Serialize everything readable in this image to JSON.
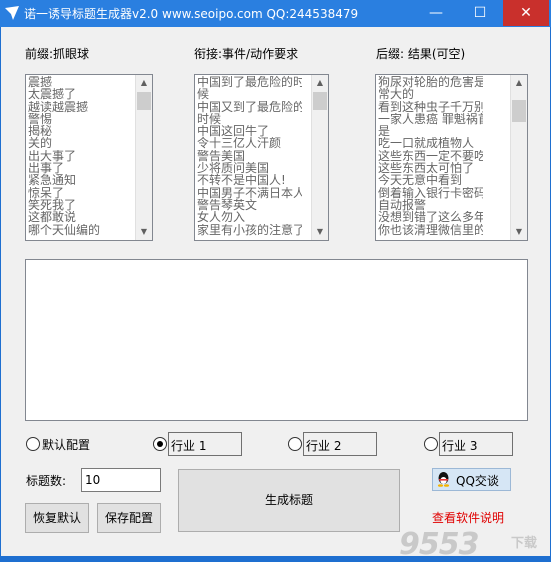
{
  "window": {
    "title": "诺一诱导标题生成器v2.0 www.seoipo.com QQ:244538479",
    "min_symbol": "—",
    "max_symbol": "☐",
    "close_symbol": "✕"
  },
  "prefix": {
    "label": "前缀:抓眼球",
    "items": [
      "震撼",
      "太震撼了",
      "越读越震撼",
      "警惕",
      "揭秘",
      "关的",
      "出大事了",
      "出事了",
      "紧急通知",
      "惊呆了",
      "笑死我了",
      "这都敢说",
      "哪个天仙编的"
    ]
  },
  "connector": {
    "label": "衔接:事件/动作要求",
    "items": [
      "中国到了最危险的时",
      "候",
      "中国又到了最危险的",
      "时候",
      "中国这回牛了",
      "令十三亿人汗颜",
      "警告美国",
      "少将质问美国",
      "不转不是中国人!",
      "中国男子不满日本人",
      "警告琴英文",
      "女人勿入",
      "家里有小孩的注意了"
    ]
  },
  "suffix": {
    "label": "后缀: 结果(可空)",
    "items": [
      "狗尿对轮胎的危害是非",
      "常大的",
      "看到这种虫子千万别打",
      "一家人患癌 罪魁祸首",
      "是",
      "吃一口就成植物人",
      "这些东西一定不要吃",
      "这些东西太可怕了",
      "今天无意中看到",
      "倒着输入银行卡密码能",
      "自动报警",
      "没想到错了这么多年",
      "你也该清理微信里的死"
    ]
  },
  "options": {
    "default_config": "默认配置",
    "industry1": "行业 1",
    "industry2": "行业 2",
    "industry3": "行业 3"
  },
  "count": {
    "label": "标题数:",
    "value": "10"
  },
  "buttons": {
    "restore_default": "恢复默认",
    "save_config": "保存配置",
    "generate": "生成标题",
    "qq_chat": "QQ交谈",
    "view_manual": "查看软件说明"
  },
  "watermark": {
    "text": "9553",
    "sub": "下载"
  }
}
